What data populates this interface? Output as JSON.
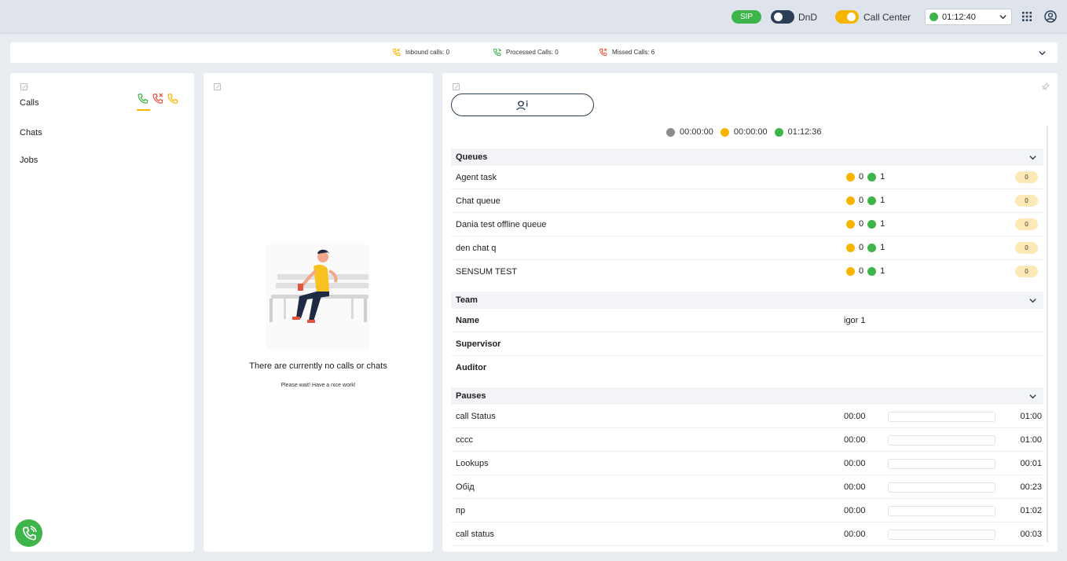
{
  "header": {
    "sip_label": "SIP",
    "dnd_label": "DnD",
    "call_center_label": "Call Center",
    "status_time": "01:12:40",
    "status_color": "#3db54a"
  },
  "stats": {
    "inbound": "Inbound calls: 0",
    "processed": "Processed Calls: 0",
    "missed": "Missed Calls: 6"
  },
  "left_nav": {
    "items": [
      {
        "label": "Calls"
      },
      {
        "label": "Chats"
      },
      {
        "label": "Jobs"
      }
    ]
  },
  "middle": {
    "empty_title": "There are currently no calls or chats",
    "empty_subtitle": "Please wait! Have a nice work!"
  },
  "timers": [
    {
      "value": "00:00:00",
      "color": "#8c8c8c"
    },
    {
      "value": "00:00:00",
      "color": "#f7b500"
    },
    {
      "value": "01:12:36",
      "color": "#3db54a"
    }
  ],
  "queues": {
    "title": "Queues",
    "rows": [
      {
        "name": "Agent task",
        "yellow": "0",
        "green": "1",
        "badge": "0"
      },
      {
        "name": "Chat queue",
        "yellow": "0",
        "green": "1",
        "badge": "0"
      },
      {
        "name": "Dania test offline queue",
        "yellow": "0",
        "green": "1",
        "badge": "0"
      },
      {
        "name": "den chat q",
        "yellow": "0",
        "green": "1",
        "badge": "0"
      },
      {
        "name": "SENSUM TEST",
        "yellow": "0",
        "green": "1",
        "badge": "0"
      }
    ]
  },
  "team": {
    "title": "Team",
    "name_label": "Name",
    "name_value": "igor 1",
    "supervisor_label": "Supervisor",
    "auditor_label": "Auditor"
  },
  "pauses": {
    "title": "Pauses",
    "rows": [
      {
        "name": "call Status",
        "spent": "00:00",
        "limit": "01:00"
      },
      {
        "name": "cccc",
        "spent": "00:00",
        "limit": "01:00"
      },
      {
        "name": "Lookups",
        "spent": "00:00",
        "limit": "00:01"
      },
      {
        "name": "Обід",
        "spent": "00:00",
        "limit": "00:23"
      },
      {
        "name": "пр",
        "spent": "00:00",
        "limit": "01:02"
      },
      {
        "name": "call status",
        "spent": "00:00",
        "limit": "00:03"
      }
    ]
  }
}
